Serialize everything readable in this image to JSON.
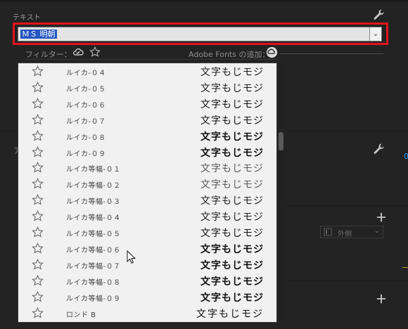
{
  "panel": {
    "section_label": "テキスト",
    "left_label": "ア",
    "blue_edge": "0"
  },
  "font_select": {
    "value": "ＭＳ 明朝",
    "chevron": "⌄"
  },
  "filter": {
    "label": "フィルター：",
    "adobe_label": "Adobe Fonts の追加："
  },
  "align": {
    "value": "外側",
    "chevron": "⌄"
  },
  "icons": {
    "wrench": "wrench-icon",
    "cloud": "cloud-check-icon",
    "star": "star-icon",
    "cc": "creative-cloud-icon",
    "plus": "plus-icon",
    "cursor": "mouse-pointer-icon"
  },
  "font_list": {
    "sample_text": "文字もじモジ",
    "items": [
      {
        "name": "ルイカ-０４"
      },
      {
        "name": "ルイカ-０５"
      },
      {
        "name": "ルイカ-０６"
      },
      {
        "name": "ルイカ-０７"
      },
      {
        "name": "ルイカ-０８"
      },
      {
        "name": "ルイカ-０９"
      },
      {
        "name": "ルイカ等幅-０１"
      },
      {
        "name": "ルイカ等幅-０２"
      },
      {
        "name": "ルイカ等幅-０３"
      },
      {
        "name": "ルイカ等幅-０４"
      },
      {
        "name": "ルイカ等幅-０５"
      },
      {
        "name": "ルイカ等幅-０６"
      },
      {
        "name": "ルイカ等幅-０７"
      },
      {
        "name": "ルイカ等幅-０８"
      },
      {
        "name": "ルイカ等幅-０９"
      },
      {
        "name": "ロンド B"
      }
    ]
  }
}
